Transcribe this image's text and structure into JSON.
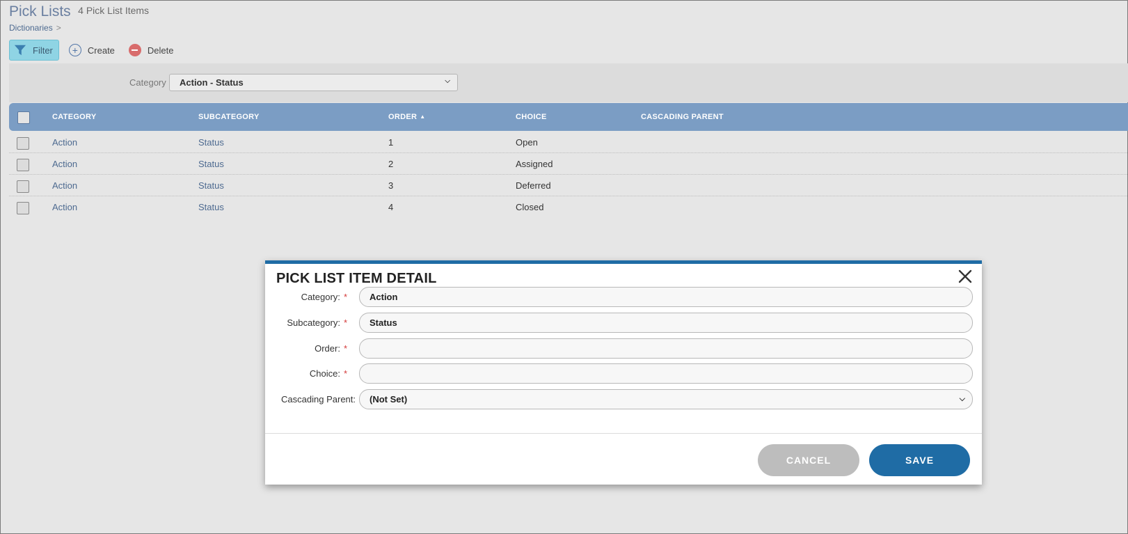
{
  "header": {
    "title": "Pick Lists",
    "count": "4 Pick List Items"
  },
  "breadcrumb": {
    "item": "Dictionaries",
    "separator": ">"
  },
  "toolbar": {
    "filter_label": "Filter",
    "create_label": "Create",
    "delete_label": "Delete"
  },
  "filter": {
    "category_label": "Category",
    "category_value": "Action - Status"
  },
  "table": {
    "columns": [
      "CATEGORY",
      "SUBCATEGORY",
      "ORDER",
      "CHOICE",
      "CASCADING PARENT"
    ],
    "sort_column": "ORDER",
    "sort_direction": "ascending",
    "rows": [
      {
        "category": "Action",
        "subcategory": "Status",
        "order": "1",
        "choice": "Open",
        "cascading_parent": ""
      },
      {
        "category": "Action",
        "subcategory": "Status",
        "order": "2",
        "choice": "Assigned",
        "cascading_parent": ""
      },
      {
        "category": "Action",
        "subcategory": "Status",
        "order": "3",
        "choice": "Deferred",
        "cascading_parent": ""
      },
      {
        "category": "Action",
        "subcategory": "Status",
        "order": "4",
        "choice": "Closed",
        "cascading_parent": ""
      }
    ]
  },
  "modal": {
    "title": "PICK LIST ITEM DETAIL",
    "fields": {
      "category": {
        "label": "Category:",
        "value": "Action",
        "required_mark": "*"
      },
      "subcategory": {
        "label": "Subcategory:",
        "value": "Status",
        "required_mark": "*"
      },
      "order": {
        "label": "Order:",
        "value": "",
        "required_mark": "*"
      },
      "choice": {
        "label": "Choice:",
        "value": "",
        "required_mark": "*"
      },
      "cascading_parent": {
        "label": "Cascading Parent:",
        "value": "(Not Set)"
      }
    },
    "cancel_label": "CANCEL",
    "save_label": "SAVE"
  },
  "icons": {
    "filter": "filter-icon",
    "create": "circle-plus-icon",
    "delete": "circle-minus-icon",
    "close": "close-icon",
    "dropdown": "chevron-down-icon",
    "sort": "sort-ascending-icon"
  },
  "colors": {
    "accent": "#1f6ca5",
    "table_header": "#7b9dc4",
    "filter_button": "#8fd4e4",
    "required": "#d43b3b",
    "link": "#4d6a90"
  }
}
